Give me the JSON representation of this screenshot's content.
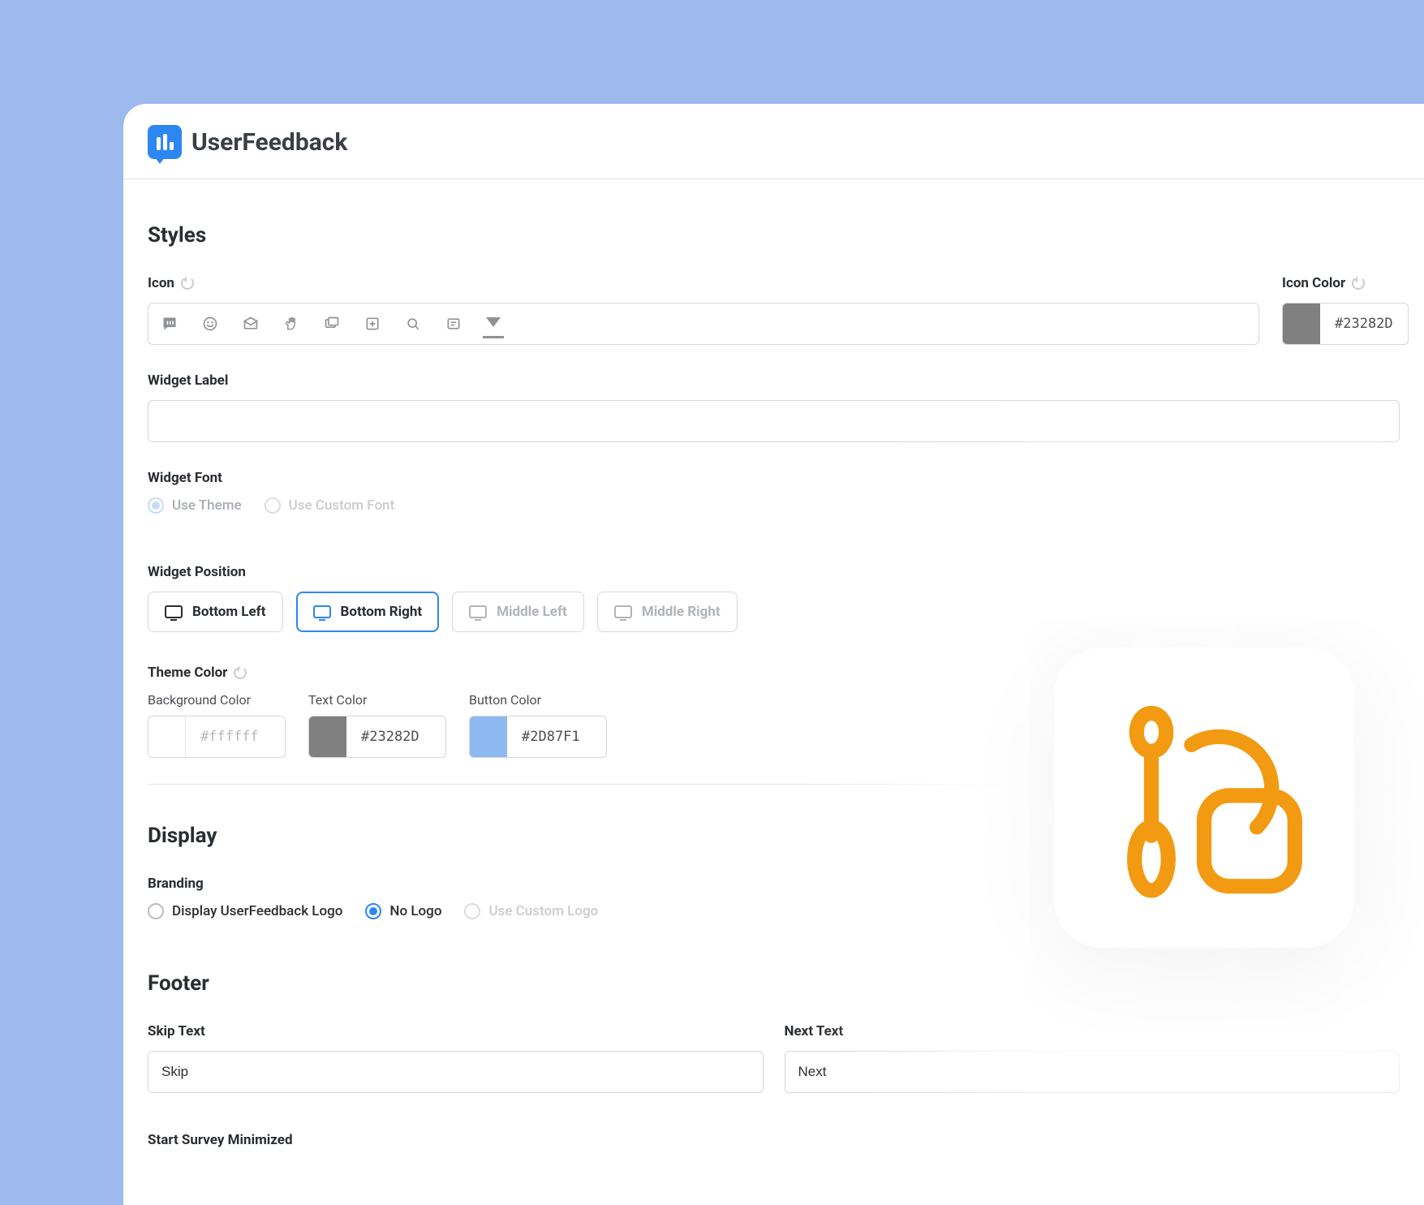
{
  "brand": {
    "name": "UserFeedback"
  },
  "styles": {
    "title": "Styles",
    "icon_label": "Icon",
    "icon_color_label": "Icon Color",
    "icon_color": {
      "hex": "#23282D",
      "swatch": "#808080"
    },
    "widget_label_label": "Widget Label",
    "widget_label_value": "",
    "widget_font_label": "Widget Font",
    "font_options": [
      {
        "label": "Use Theme",
        "state": "selected_light"
      },
      {
        "label": "Use Custom Font",
        "state": "normal"
      }
    ],
    "widget_position_label": "Widget Position",
    "positions": [
      {
        "label": "Bottom Left",
        "active": false,
        "disabled": false
      },
      {
        "label": "Bottom Right",
        "active": true,
        "disabled": false
      },
      {
        "label": "Middle Left",
        "active": false,
        "disabled": true
      },
      {
        "label": "Middle Right",
        "active": false,
        "disabled": true
      }
    ],
    "theme_color_label": "Theme Color",
    "colors": {
      "background": {
        "label": "Background Color",
        "hex": "#ffffff",
        "swatch": "#ffffff"
      },
      "text": {
        "label": "Text Color",
        "hex": "#23282D",
        "swatch": "#808080"
      },
      "button": {
        "label": "Button Color",
        "hex": "#2D87F1",
        "swatch": "#8eb8f0"
      }
    }
  },
  "display": {
    "title": "Display",
    "branding_label": "Branding",
    "branding_options": [
      {
        "label": "Display UserFeedback Logo",
        "state": "normal"
      },
      {
        "label": "No Logo",
        "state": "selected"
      },
      {
        "label": "Use Custom Logo",
        "state": "disabled"
      }
    ]
  },
  "footer": {
    "title": "Footer",
    "skip_label": "Skip Text",
    "skip_value": "Skip",
    "next_label": "Next Text",
    "next_value": "Next",
    "minimize_label": "Start Survey Minimized"
  }
}
